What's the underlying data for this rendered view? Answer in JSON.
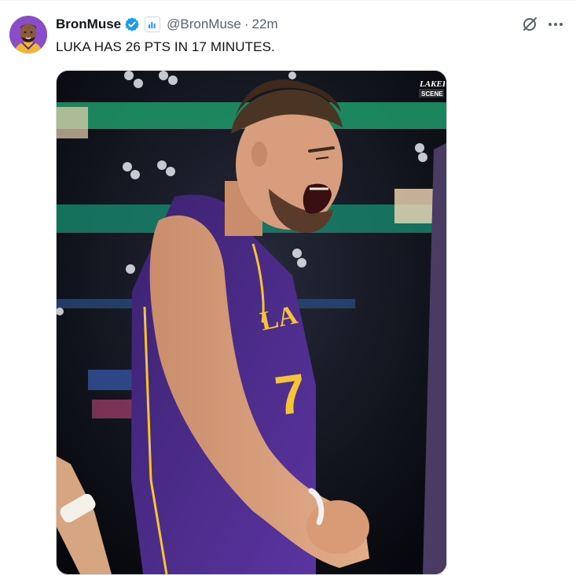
{
  "tweet": {
    "author": {
      "display_name": "BronMuse",
      "handle": "@BronMuse",
      "verified": true,
      "affiliation_icon": "bar-chart-badge-icon",
      "avatar": "cartoon-avatar"
    },
    "separator": "·",
    "time": "22m",
    "text": "LUKA HAS 26 PTS IN 17 MINUTES.",
    "media": {
      "type": "photo",
      "watermark_line1": "LAKER",
      "watermark_line2": "SCENE"
    },
    "actions": {
      "grok_icon": "grok-icon",
      "more_icon": "more-icon"
    }
  },
  "colors": {
    "verified": "#1d9bf0",
    "text_primary": "#0f1419",
    "text_secondary": "#536471",
    "lakers_purple": "#4b2a86",
    "lakers_gold": "#f6c437"
  }
}
